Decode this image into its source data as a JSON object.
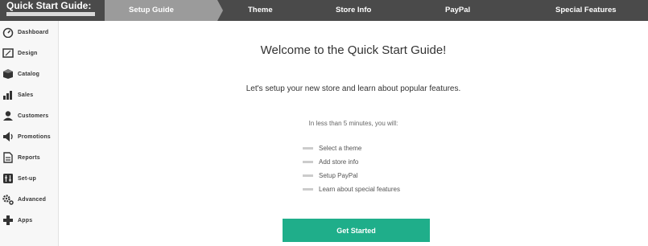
{
  "header": {
    "brand_title": "Quick Start Guide:",
    "steps": [
      {
        "label": "Setup Guide",
        "active": true
      },
      {
        "label": "Theme",
        "active": false
      },
      {
        "label": "Store Info",
        "active": false
      },
      {
        "label": "PayPal",
        "active": false
      },
      {
        "label": "Special Features",
        "active": false
      }
    ]
  },
  "sidebar": {
    "items": [
      {
        "label": "Dashboard",
        "icon": "dashboard-icon"
      },
      {
        "label": "Design",
        "icon": "design-icon"
      },
      {
        "label": "Catalog",
        "icon": "catalog-icon"
      },
      {
        "label": "Sales",
        "icon": "sales-icon"
      },
      {
        "label": "Customers",
        "icon": "customers-icon"
      },
      {
        "label": "Promotions",
        "icon": "promotions-icon"
      },
      {
        "label": "Reports",
        "icon": "reports-icon"
      },
      {
        "label": "Set-up",
        "icon": "setup-icon"
      },
      {
        "label": "Advanced",
        "icon": "advanced-icon"
      },
      {
        "label": "Apps",
        "icon": "apps-icon"
      }
    ]
  },
  "main": {
    "title": "Welcome to the Quick Start Guide!",
    "subtitle": "Let's setup your new store and learn about popular features.",
    "intro": "In less than 5 minutes, you will:",
    "features": [
      "Select a theme",
      "Add store info",
      "Setup PayPal",
      "Learn about special features"
    ],
    "cta_label": "Get Started"
  },
  "colors": {
    "topbar": "#4a4a4a",
    "active_step": "#9b9b9b",
    "cta": "#1fae8a",
    "sidebar": "#f7f7f7"
  }
}
